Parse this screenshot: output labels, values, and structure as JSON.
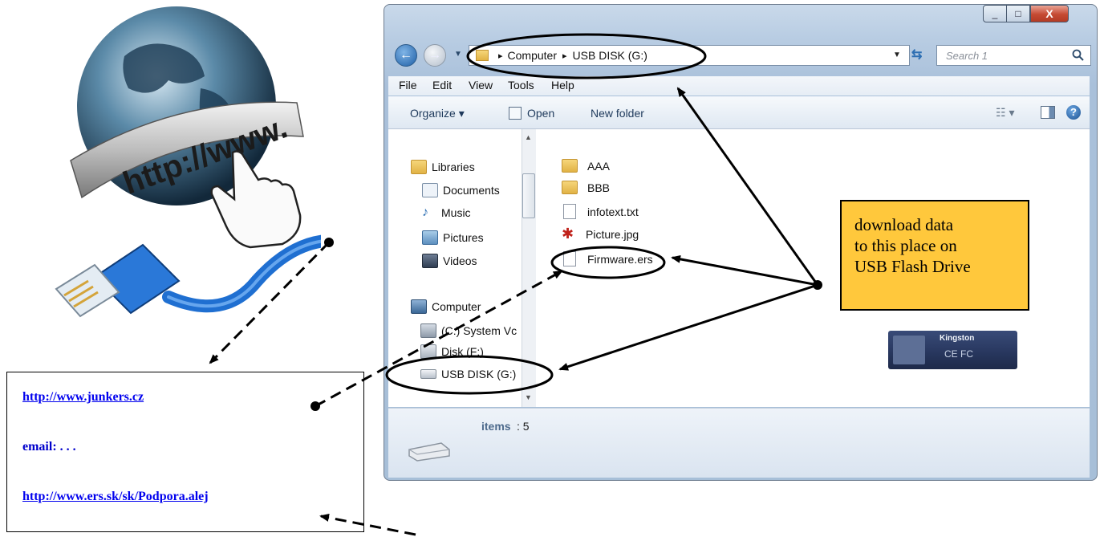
{
  "links": {
    "junkers": "http://www.junkers.cz",
    "email": "email: . . .",
    "ers": "http://www.ers.sk/sk/Podpora.alej"
  },
  "globe": {
    "banner_text": "http://www."
  },
  "window": {
    "controls": {
      "minimize": "_",
      "maximize": "□",
      "close": "X"
    },
    "address": {
      "crumb_1": "Computer",
      "crumb_2": "USB DISK (G:)",
      "separator": "▸"
    },
    "search_placeholder": "Search 1",
    "menu": [
      "File",
      "Edit",
      "View",
      "Tools",
      "Help"
    ],
    "toolbar": {
      "organize": "Organize ▾",
      "open": "Open",
      "new_folder": "New folder"
    },
    "nav": {
      "libraries": "Libraries",
      "documents": "Documents",
      "music": "Music",
      "pictures": "Pictures",
      "videos": "Videos",
      "computer": "Computer",
      "drive_c": "(C:) System Vc",
      "drive_f": "Disk (F:)",
      "drive_g": "USB DISK (G:)"
    },
    "files": [
      "AAA",
      "BBB",
      "infotext.txt",
      "Picture.jpg",
      "Firmware.ers"
    ],
    "details": {
      "items_label": "items",
      "items_value": ": 5"
    }
  },
  "callout": {
    "line1": "download data",
    "line2": "to this place on",
    "line3": "USB Flash Drive"
  },
  "usb_stick": {
    "brand": "Kingston",
    "marks": "CE FC"
  },
  "colors": {
    "callout_bg": "#ffc83c",
    "link": "#0000ee",
    "cable": "#1f6fd1"
  }
}
